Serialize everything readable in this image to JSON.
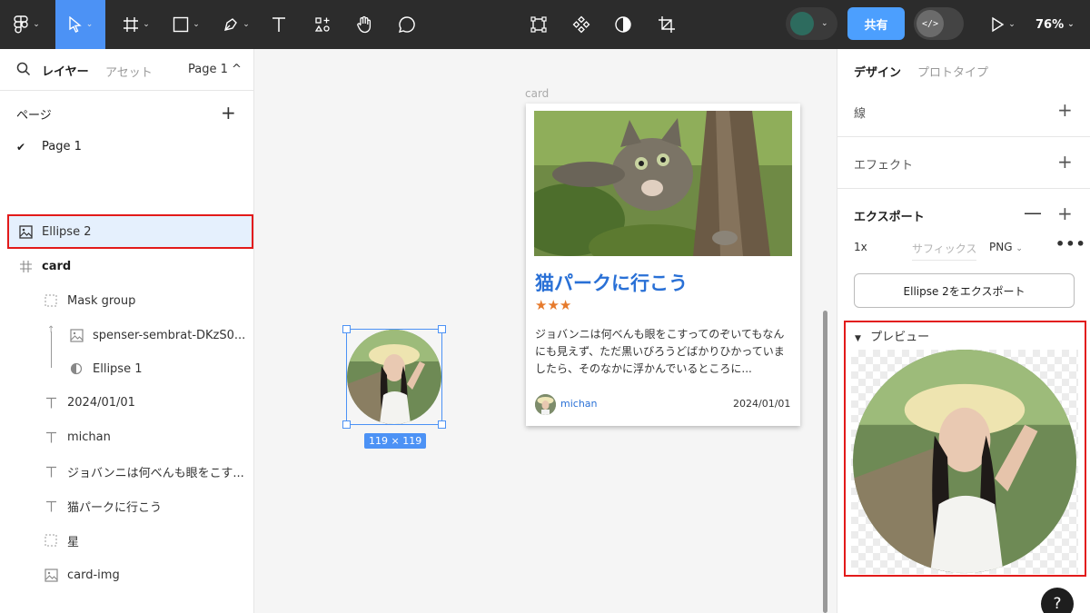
{
  "toolbar": {
    "share_label": "共有",
    "zoom_label": "76%",
    "dev_label": "</>"
  },
  "left_panel": {
    "tab_layers": "レイヤー",
    "tab_assets": "アセット",
    "page_selector": "Page 1 ^",
    "pages_title": "ページ",
    "pages_add": "+",
    "current_page": "Page 1",
    "layers": [
      {
        "label": "Ellipse 2"
      },
      {
        "label": "card"
      },
      {
        "label": "Mask group"
      },
      {
        "label": "spenser-sembrat-DKzS0..."
      },
      {
        "label": "Ellipse 1"
      },
      {
        "label": "2024/01/01"
      },
      {
        "label": "michan"
      },
      {
        "label": "ジョバンニは何べんも眼をこす..."
      },
      {
        "label": "猫パークに行こう"
      },
      {
        "label": "星"
      },
      {
        "label": "card-img"
      }
    ]
  },
  "canvas": {
    "frame_label": "card",
    "card": {
      "title": "猫パークに行こう",
      "stars": "★★★",
      "body": "ジョバンニは何べんも眼をこすってのぞいてもなんにも見えず、ただ黒いびろうどばかりひかっていましたら、そのなかに浮かんでいるところに...",
      "user": "michan",
      "date": "2024/01/01"
    },
    "selection_size": "119 × 119"
  },
  "right_panel": {
    "tab_design": "デザイン",
    "tab_prototype": "プロトタイプ",
    "stroke_label": "線",
    "effect_label": "エフェクト",
    "export_label": "エクスポート",
    "export_scale": "1x",
    "export_suffix_placeholder": "サフィックス",
    "export_format": "PNG",
    "export_button": "Ellipse 2をエクスポート",
    "preview_label": "プレビュー",
    "help": "?"
  },
  "colors": {
    "accent": "#4c92f5",
    "highlight": "#e21a1a",
    "toolbar_bg": "#2c2c2c",
    "card_title": "#2970d6",
    "stars": "#e67a2c"
  }
}
